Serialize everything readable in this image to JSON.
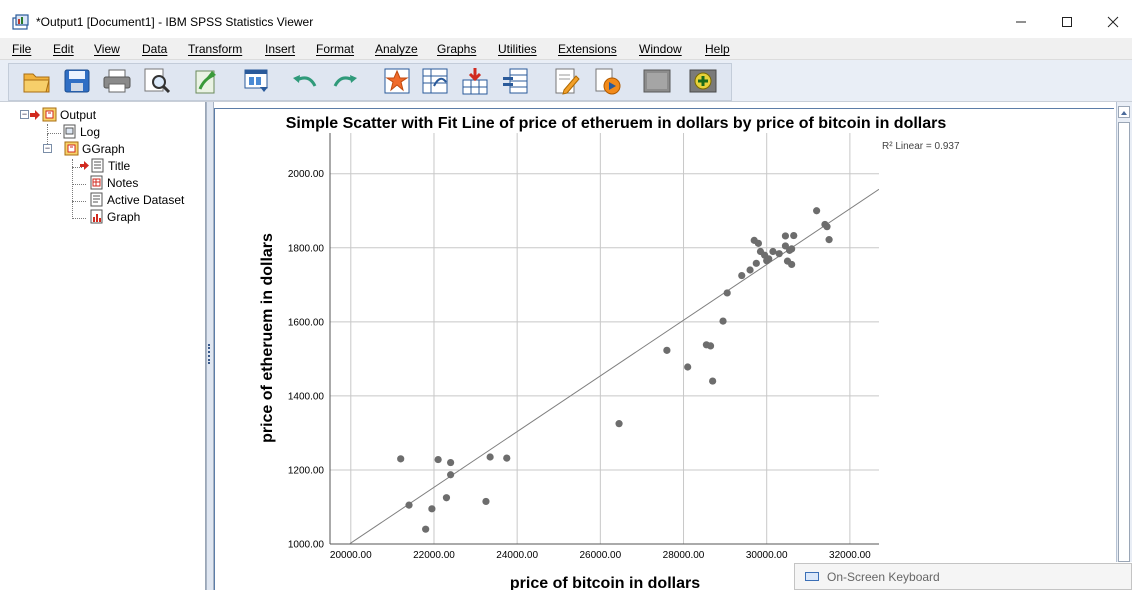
{
  "window": {
    "title": "*Output1 [Document1] - IBM SPSS Statistics Viewer",
    "minimize_glyph": "—",
    "maximize_glyph": "☐",
    "close_glyph": "✕"
  },
  "menu": [
    {
      "label": "File"
    },
    {
      "label": "Edit"
    },
    {
      "label": "View"
    },
    {
      "label": "Data"
    },
    {
      "label": "Transform"
    },
    {
      "label": "Insert"
    },
    {
      "label": "Format"
    },
    {
      "label": "Analyze"
    },
    {
      "label": "Graphs"
    },
    {
      "label": "Utilities"
    },
    {
      "label": "Extensions"
    },
    {
      "label": "Window"
    },
    {
      "label": "Help"
    }
  ],
  "toolbar": {
    "icons": [
      "open-folder-icon",
      "save-icon",
      "print-icon",
      "print-preview-icon",
      "export-icon",
      "recall-dialog-icon",
      "undo-icon",
      "redo-icon",
      "goto-data-icon",
      "goto-case-icon",
      "goto-variable-icon",
      "variables-icon",
      "edit-output-icon",
      "run-script-icon",
      "collapse-output-icon",
      "insert-output-icon"
    ]
  },
  "tree": {
    "root": "Output",
    "log": "Log",
    "ggraph": "GGraph",
    "children": [
      "Title",
      "Notes",
      "Active Dataset",
      "Graph"
    ]
  },
  "osk": {
    "label": "On-Screen Keyboard"
  },
  "chart_data": {
    "type": "scatter",
    "title": "Simple Scatter with Fit Line of price of etheruem in dollars by price of bitcoin in dollars",
    "xlabel": "price of bitcoin in dollars",
    "ylabel": "price of etheruem in dollars",
    "xlim": [
      19500,
      32700
    ],
    "ylim": [
      1000,
      2110
    ],
    "xticks": [
      "20000.00",
      "22000.00",
      "24000.00",
      "26000.00",
      "28000.00",
      "30000.00",
      "32000.00"
    ],
    "xtick_values": [
      20000,
      22000,
      24000,
      26000,
      28000,
      30000,
      32000
    ],
    "yticks": [
      "1000.00",
      "1200.00",
      "1400.00",
      "1600.00",
      "1800.00",
      "2000.00"
    ],
    "ytick_values": [
      1000,
      1200,
      1400,
      1600,
      1800,
      2000
    ],
    "grid": true,
    "r2_label": "R² Linear = 0.937",
    "fit_line": {
      "x": [
        19500,
        32700
      ],
      "y": [
        965,
        1958
      ]
    },
    "points": [
      {
        "x": 21200,
        "y": 1230
      },
      {
        "x": 21400,
        "y": 1105
      },
      {
        "x": 21800,
        "y": 1040
      },
      {
        "x": 21950,
        "y": 1095
      },
      {
        "x": 22100,
        "y": 1228
      },
      {
        "x": 22300,
        "y": 1125
      },
      {
        "x": 22400,
        "y": 1220
      },
      {
        "x": 22400,
        "y": 1187
      },
      {
        "x": 23250,
        "y": 1115
      },
      {
        "x": 23350,
        "y": 1235
      },
      {
        "x": 23750,
        "y": 1232
      },
      {
        "x": 26450,
        "y": 1325
      },
      {
        "x": 27600,
        "y": 1523
      },
      {
        "x": 28100,
        "y": 1478
      },
      {
        "x": 28550,
        "y": 1538
      },
      {
        "x": 28650,
        "y": 1535
      },
      {
        "x": 28700,
        "y": 1440
      },
      {
        "x": 28950,
        "y": 1602
      },
      {
        "x": 29050,
        "y": 1678
      },
      {
        "x": 29400,
        "y": 1725
      },
      {
        "x": 29600,
        "y": 1740
      },
      {
        "x": 29700,
        "y": 1820
      },
      {
        "x": 29750,
        "y": 1758
      },
      {
        "x": 29800,
        "y": 1812
      },
      {
        "x": 29850,
        "y": 1790
      },
      {
        "x": 29950,
        "y": 1780
      },
      {
        "x": 30000,
        "y": 1765
      },
      {
        "x": 30050,
        "y": 1770
      },
      {
        "x": 30150,
        "y": 1790
      },
      {
        "x": 30300,
        "y": 1784
      },
      {
        "x": 30450,
        "y": 1832
      },
      {
        "x": 30450,
        "y": 1805
      },
      {
        "x": 30550,
        "y": 1793
      },
      {
        "x": 30500,
        "y": 1764
      },
      {
        "x": 30600,
        "y": 1755
      },
      {
        "x": 30650,
        "y": 1833
      },
      {
        "x": 30600,
        "y": 1797
      },
      {
        "x": 31200,
        "y": 1900
      },
      {
        "x": 31400,
        "y": 1863
      },
      {
        "x": 31450,
        "y": 1857
      },
      {
        "x": 31500,
        "y": 1822
      }
    ],
    "point_color": "#6d6d6d",
    "grid_color": "#c8c8c8",
    "line_color": "#7f7f7f"
  }
}
